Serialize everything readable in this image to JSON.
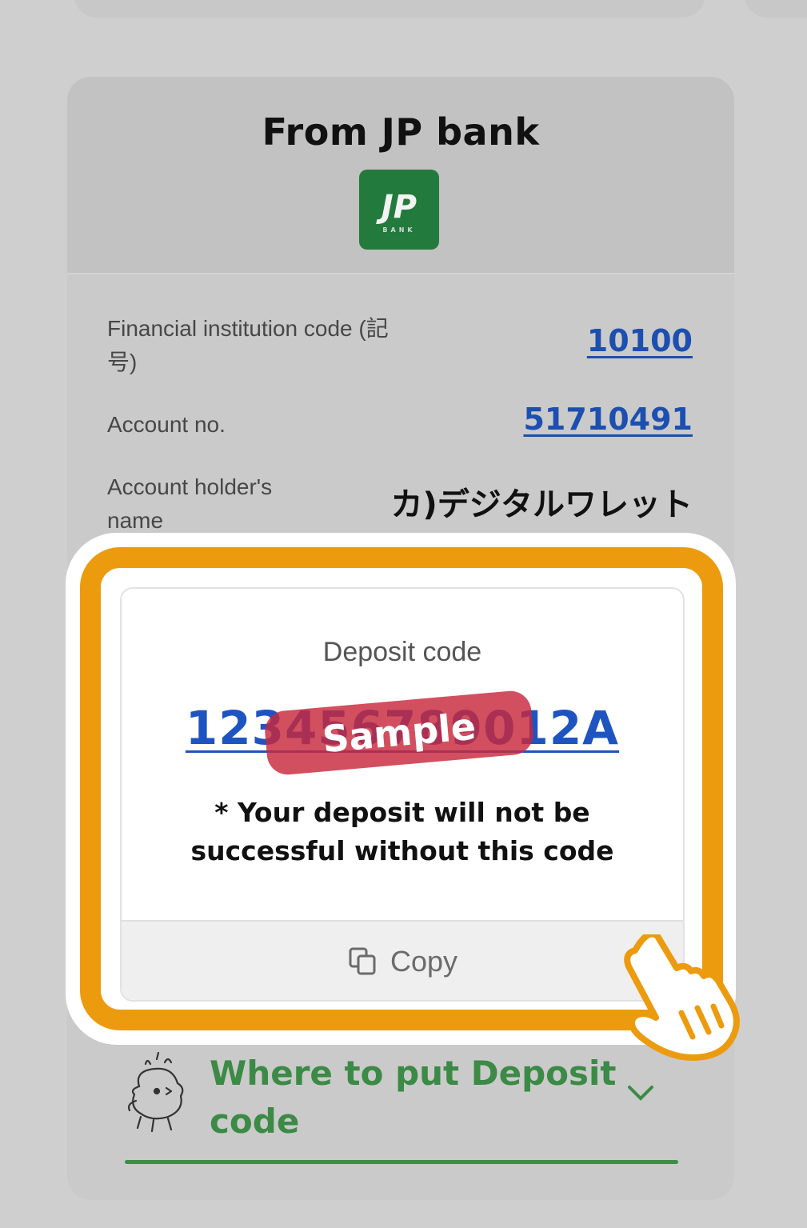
{
  "card": {
    "title": "From JP bank",
    "logo": {
      "main_text": "JP",
      "sub_text": "BANK",
      "color": "#237a3d"
    }
  },
  "account_info": {
    "financial_code_label": "Financial institution code (記号)",
    "financial_code_value": "10100",
    "account_no_label": "Account no.",
    "account_no_value": "51710491",
    "holder_label": "Account holder's name",
    "holder_value": "カ)デジタルワレット"
  },
  "deposit": {
    "label": "Deposit code",
    "code": "123456789012A",
    "sample_stamp": "Sample",
    "note_line1": "* Your deposit will not be",
    "note_line2": "successful without this code",
    "copy_label": "Copy",
    "copy_icon": "copy-icon"
  },
  "howto": {
    "text": "Where to put Deposit code",
    "icon": "chevron-down-icon",
    "mascot": "confused-mascot"
  },
  "highlight": {
    "frame_color": "#ec9b0f",
    "pointer": "pointing-hand-icon"
  },
  "colors": {
    "link_blue": "#1c4fb0",
    "green": "#3b8a45",
    "stamp_red": "#c8283c"
  }
}
